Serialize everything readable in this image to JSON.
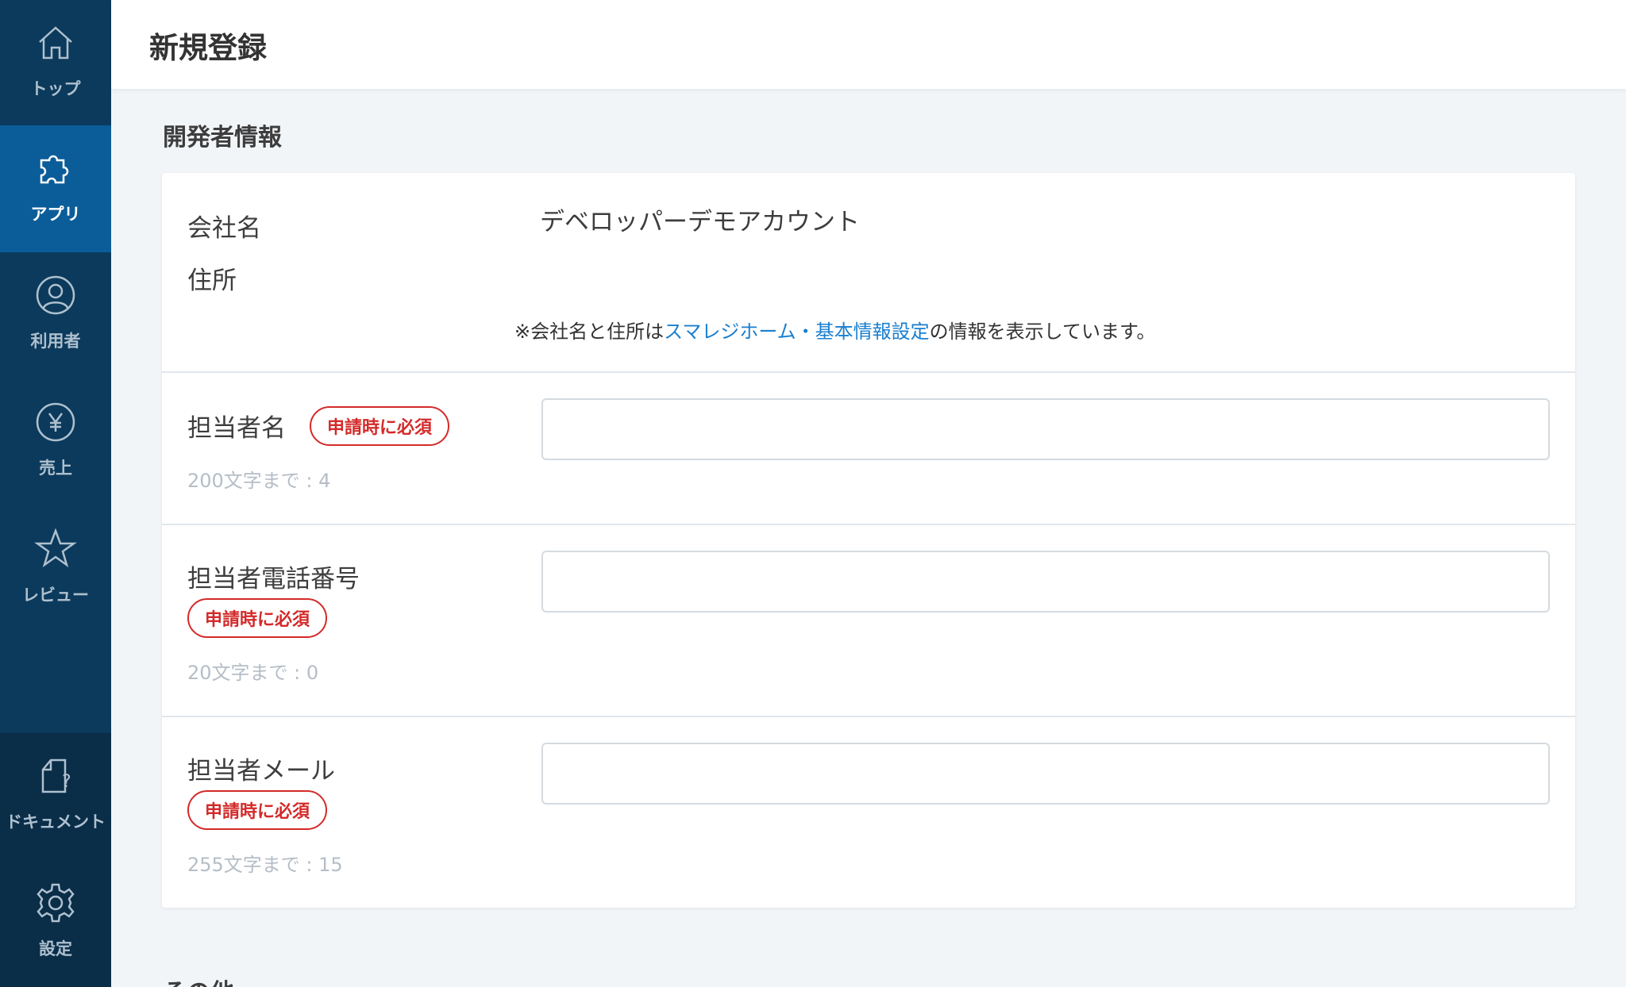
{
  "sidebar": {
    "items": [
      {
        "label": "トップ",
        "icon": "home-icon"
      },
      {
        "label": "アプリ",
        "icon": "puzzle-icon",
        "active": true
      },
      {
        "label": "利用者",
        "icon": "user-icon"
      },
      {
        "label": "売上",
        "icon": "yen-icon"
      },
      {
        "label": "レビュー",
        "icon": "star-icon"
      }
    ],
    "bottom_items": [
      {
        "label": "ドキュメント",
        "icon": "document-help-icon"
      },
      {
        "label": "設定",
        "icon": "gear-icon"
      }
    ]
  },
  "header": {
    "title": "新規登録"
  },
  "developer_section": {
    "title": "開発者情報",
    "company_label": "会社名",
    "company_value": "デベロッパーデモアカウント",
    "address_label": "住所",
    "note_prefix": "※会社名と住所は",
    "note_link": "スマレジホーム・基本情報設定",
    "note_suffix": "の情報を表示しています。"
  },
  "fields": [
    {
      "label": "担当者名",
      "badge": "申請時に必須",
      "counter": "200文字まで : 4",
      "value": ""
    },
    {
      "label": "担当者電話番号",
      "badge": "申請時に必須",
      "counter": "20文字まで : 0",
      "value": ""
    },
    {
      "label": "担当者メール",
      "badge": "申請時に必須",
      "counter": "255文字まで : 15",
      "value": ""
    }
  ],
  "next_section": {
    "title": "その他"
  },
  "colors": {
    "sidebar_bg": "#0c3a5c",
    "sidebar_active": "#0b5d99",
    "required_red": "#d42a2a",
    "link_blue": "#1a7fcf"
  }
}
